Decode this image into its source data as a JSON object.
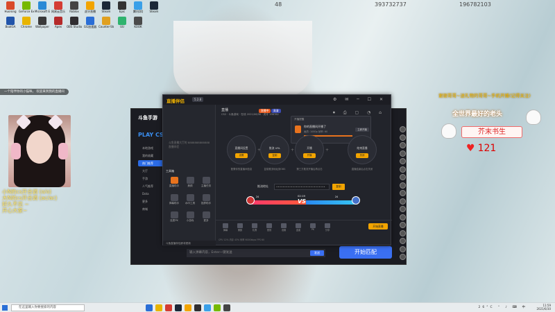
{
  "desktop": {
    "icons": [
      {
        "label": "Huorong",
        "color": "#d94a2a"
      },
      {
        "label": "GeForce Experience",
        "color": "#76b900"
      },
      {
        "label": "Microsoft Edge",
        "color": "#2a8ad6"
      },
      {
        "label": "网易云音乐",
        "color": "#d43c33"
      },
      {
        "label": "Roblox",
        "color": "#444"
      },
      {
        "label": "虎牙直播",
        "color": "#f2a400"
      },
      {
        "label": "Steam",
        "color": "#1b2838"
      },
      {
        "label": "Epic",
        "color": "#333"
      },
      {
        "label": "腾讯QQ",
        "color": "#3aa0e8"
      },
      {
        "label": "Steam",
        "color": "#1b2838"
      },
      {
        "label": "BoatGA",
        "color": "#2255aa"
      },
      {
        "label": "Chrome",
        "color": "#e8b400"
      },
      {
        "label": "Wallpaper",
        "color": "#3a3a3a"
      },
      {
        "label": "Apex",
        "color": "#b52a2a"
      },
      {
        "label": "OBS Studio",
        "color": "#302e31"
      },
      {
        "label": "GG加速器",
        "color": "#2a6ed6"
      },
      {
        "label": "Counter-Strike",
        "color": "#e0a020"
      },
      {
        "label": "UU",
        "color": "#2fb36e"
      },
      {
        "label": "KOOK",
        "color": "#4a4a4a"
      }
    ]
  },
  "stream_overlay": {
    "top_stats_left": "48",
    "top_stats_mid": "393732737",
    "top_stats_right": "196782103",
    "ticker": "一个陪伴你的小猫咪，  欢迎来到我的直播间",
    "cam_caption": "小N的cs开合调 (o/o)\n大N的cs开合调 (ac/ac)\n好久不见 ~\n开心大家~",
    "gift_line": "谢谢哥哥~送礼物的哥哥~手机开播(记得关注)",
    "top_banner": "全世界最好的老头",
    "fan_name": "芥末书生",
    "heart_count": "121"
  },
  "back_window": {
    "brand": "斗鱼手游",
    "play": "PLAY CS",
    "side_items": [
      "本地游戏",
      "我的收藏",
      "热门推荐",
      "大厅",
      "手游",
      "人气推荐",
      "Dota",
      "更多",
      "商城"
    ],
    "chat_placeholder": "输入弹幕内容，Enter一键发送",
    "chat_send": "发送",
    "start_button": "开始匹配"
  },
  "main_window": {
    "logo": "直播伴侣",
    "version": "5.2.8",
    "title": "直播",
    "subtitle": "CS2 · 斗鱼游戏 · 在线 2021/06/30 · 虎牙 198782",
    "live_badge": "直播中",
    "hd_badge": "高清",
    "left_hint": "斗鱼直播大厅的 8888888888888 直播伴侣",
    "tools_label": "工具箱",
    "tools": [
      {
        "label": "直播助手",
        "on": true
      },
      {
        "label": "美颜",
        "on": false
      },
      {
        "label": "主播任务",
        "on": false
      },
      {
        "label": "弹幕助手",
        "on": false
      },
      {
        "label": "水印工具",
        "on": false
      },
      {
        "label": "投屏助手",
        "on": false
      },
      {
        "label": "连麦PK",
        "on": false
      },
      {
        "label": "小游戏",
        "on": false
      },
      {
        "label": "更多",
        "on": false
      }
    ],
    "notice": "斗鱼直播伴侣即将更新",
    "popup": {
      "header": "开播提醒",
      "title": "你的直播间开播了",
      "subtitle": "画质: 1080p  帧率: 60",
      "button": "立即开播"
    },
    "flow": [
      {
        "title": "直播间设置",
        "button": "设置",
        "desc": "配置你的直播间信息"
      },
      {
        "title": "推流 URL",
        "button": "复制",
        "desc": "复制推流地址到OBS"
      },
      {
        "title": "开播",
        "button": "开播",
        "desc": "第三方推流开播后再点击"
      },
      {
        "title": "结束直播",
        "button": "关闭",
        "desc": "直播结束后点击关闭"
      }
    ],
    "rtmp_label": "推流地址",
    "rtmp_value": "••••••••••••••••••••••••••••••",
    "rtmp_button": "复制",
    "pk": {
      "timer": "02:19",
      "left_score": "24",
      "right_score": "24",
      "vs": "VS"
    },
    "bottom_items": [
      "弹幕",
      "美颜",
      "礼物",
      "音效",
      "设置",
      "连麦",
      "PK",
      "分享"
    ],
    "go_live": "开始直播",
    "status": "CPU 12%   内存 43%   码率 6000kbps   FPS 60"
  },
  "taskbar": {
    "search_placeholder": "在这里输入你要搜索的内容",
    "time": "11:59",
    "date": "2021/6/30",
    "weather": "26°C"
  }
}
